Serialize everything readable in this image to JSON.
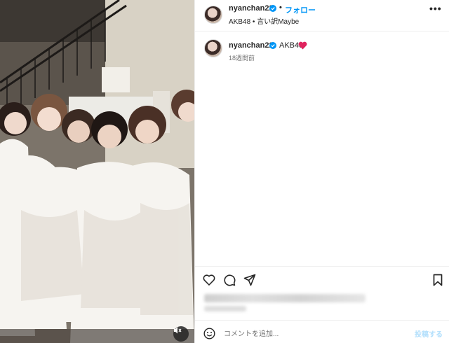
{
  "post": {
    "image_alt": "Group photo of AKB48 members in white dresses"
  },
  "header": {
    "username": "nyanchan22",
    "separator": "•",
    "follow_label": "フォロー",
    "audio_line": "AKB48 • 言い訳Maybe",
    "more_label": "•••"
  },
  "caption": {
    "username": "nyanchan22",
    "text": "AKB48",
    "emoji": "red-heart-icon",
    "time_ago": "18週間前"
  },
  "actions": {
    "icons": [
      "heart-icon",
      "comment-icon",
      "share-icon",
      "bookmark-icon"
    ]
  },
  "comment_box": {
    "placeholder": "コメントを追加...",
    "post_label": "投稿する"
  },
  "colors": {
    "follow_blue": "#0095f6",
    "verified_blue": "#0095f6",
    "post_disabled": "#b2dffc",
    "heart_red": "#e0245e"
  }
}
